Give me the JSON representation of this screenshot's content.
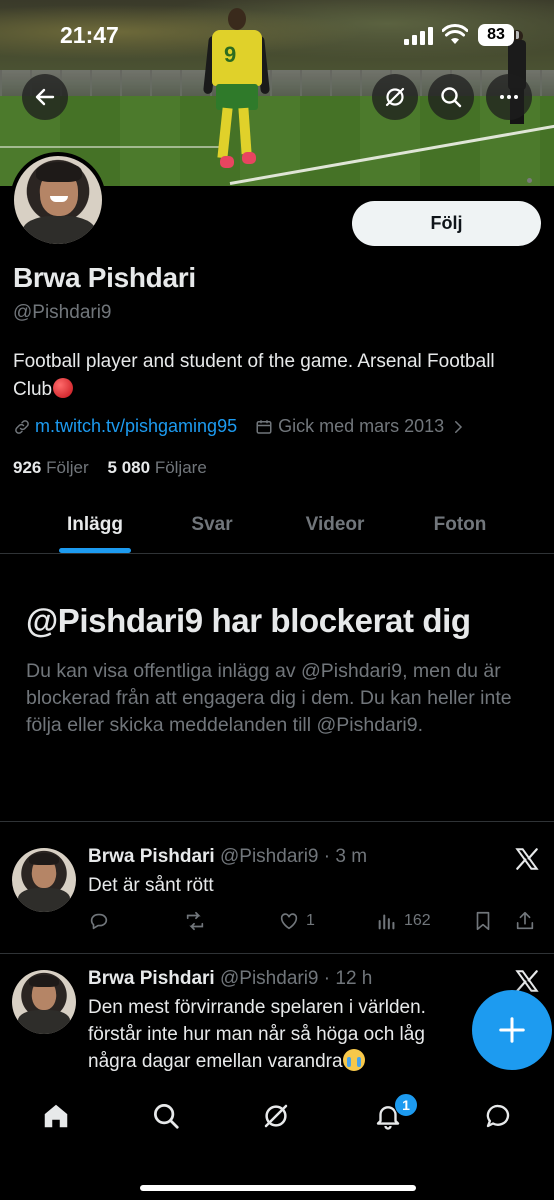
{
  "status_bar": {
    "time": "21:47",
    "battery": "83"
  },
  "header": {
    "back_icon": "arrow-left-icon",
    "grok_icon": "slash-circle-icon",
    "search_icon": "search-icon",
    "more_icon": "more-horizontal-icon"
  },
  "profile": {
    "follow_label": "Följ",
    "name": "Brwa Pishdari",
    "handle": "@Pishdari9",
    "bio": "Football player and student of the game. Arsenal Football Club",
    "link": "m.twitch.tv/pishgaming95",
    "joined": "Gick med mars 2013",
    "following_count": "926",
    "following_label": "Följer",
    "followers_count": "5 080",
    "followers_label": "Följare"
  },
  "tabs": [
    {
      "label": "Inlägg",
      "active": true
    },
    {
      "label": "Svar",
      "active": false
    },
    {
      "label": "Videor",
      "active": false
    },
    {
      "label": "Foton",
      "active": false
    }
  ],
  "blocked": {
    "title": "@Pishdari9 har blockerat dig",
    "text": "Du kan visa offentliga inlägg av @Pishdari9, men du är blockerad från att engagera dig i dem. Du kan heller inte följa eller skicka meddelanden till @Pishdari9."
  },
  "posts": [
    {
      "name": "Brwa Pishdari",
      "handle": "@Pishdari9",
      "time": "3 m",
      "text": "Det är sånt rött",
      "likes": "1",
      "views": "162"
    },
    {
      "name": "Brwa Pishdari",
      "handle": "@Pishdari9",
      "time": "12 h",
      "text_line1": "Den mest förvirrande spelaren i världen.",
      "text_line2": "förstår inte hur man når så höga och låg",
      "text_line3": "några dagar emellan varandra"
    }
  ],
  "nav": {
    "notifications_badge": "1"
  },
  "colors": {
    "accent": "#1d9bf0",
    "background": "#000000",
    "muted": "#71767b"
  }
}
